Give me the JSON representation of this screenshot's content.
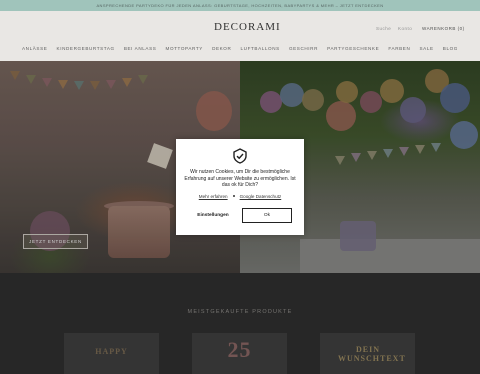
{
  "announcement": "ANSPRECHENDE PARTYDEKO FÜR JEDEN ANLASS: GEBURTSTAGE, HOCHZEITEN, BABYPARTYS & MEHR – JETZT ENTDECKEN",
  "header": {
    "logo": "DECORAMI",
    "search": "Suche",
    "account": "Konto",
    "cart": "WARENKORB (0)"
  },
  "nav": [
    "ANLÄSSE",
    "KINDERGEBURTSTAG",
    "BEI ANLASS",
    "MOTTOPARTY",
    "DEKOR",
    "LUFTBALLONS",
    "GESCHIRR",
    "PARTYGESCHENKE",
    "FARBEN",
    "SALE",
    "BLOG"
  ],
  "hero": {
    "button": "JETZT ENTDECKEN"
  },
  "section": {
    "title": "MEISTGEKAUFTE PRODUKTE",
    "products": [
      "HAPPY",
      "25",
      "DEIN WUNSCHTEXT"
    ]
  },
  "cookie": {
    "text": "Wir nutzen Cookies, um Dir die bestmögliche Erfahrung auf unserer Website zu ermöglichen. Ist das ok für Dich?",
    "learn_more": "Mehr erfahren",
    "google_privacy": "Google Datenschutz",
    "settings": "Einstellungen",
    "ok": "Ok"
  },
  "colors": {
    "announcement_bg": "#a9cfc6",
    "header_bg": "#f6f4f1",
    "modal_bg": "#ffffff"
  }
}
